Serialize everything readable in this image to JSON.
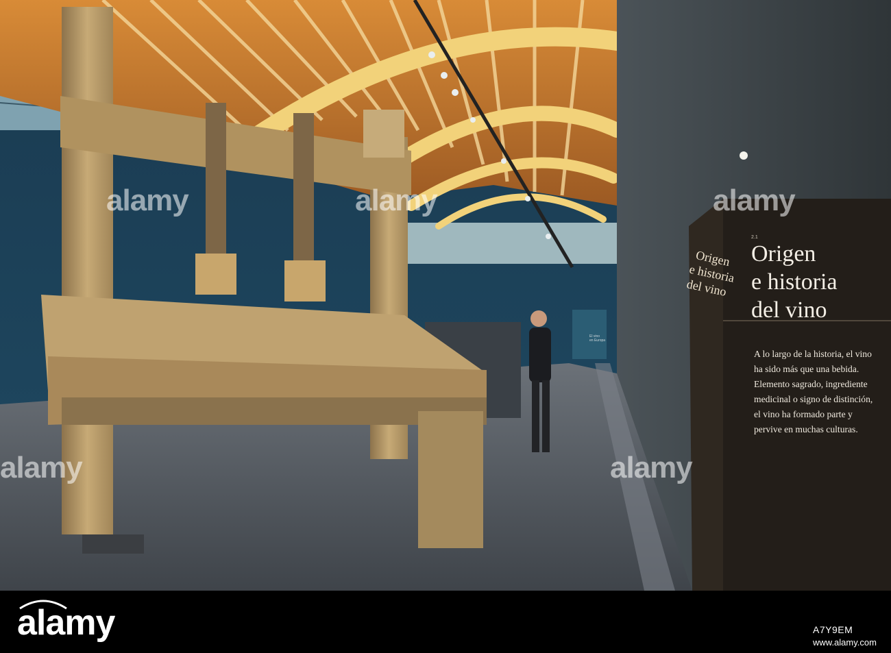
{
  "sign": {
    "number": "2.1",
    "title_lines": [
      "Origen",
      "e historia",
      "del vino"
    ],
    "vertical_lines": [
      "Origen",
      "e historia",
      "del vino"
    ],
    "body_lines": [
      "A lo largo de la historia, el vino",
      "ha sido más que una bebida.",
      "Elemento sagrado, ingrediente",
      "medicinal o signo de distinción,",
      "el vino ha formado parte y",
      "pervive en muchas culturas."
    ]
  },
  "wall_label": {
    "lines": [
      "El vino",
      "en Europa"
    ]
  },
  "watermark": {
    "text": "alamy"
  },
  "footer": {
    "logo": "alamy",
    "image_id": "A7Y9EM",
    "url": "www.alamy.com"
  },
  "colors": {
    "ceiling_wood": "#c8843a",
    "beam_glulam": "#f2d27a",
    "wall_blue": "#1f4a63",
    "floor": "#5b6066",
    "press_wood": "#b69a6a",
    "sign_panel": "#231e19",
    "sign_text": "#f4efe6"
  }
}
